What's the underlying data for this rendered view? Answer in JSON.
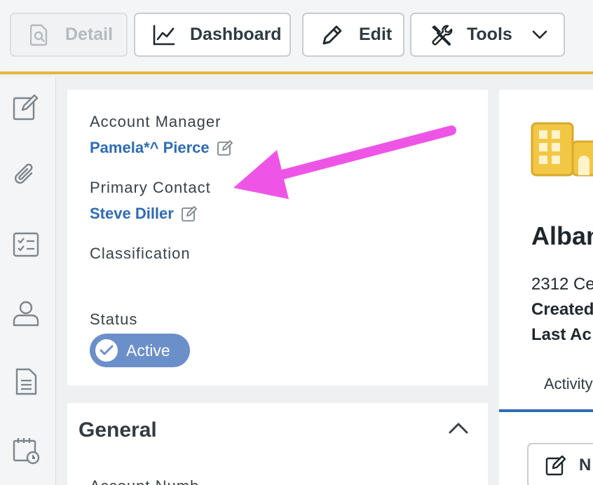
{
  "toolbar": {
    "detail_label": "Detail",
    "dashboard_label": "Dashboard",
    "edit_label": "Edit",
    "tools_label": "Tools",
    "accent_color": "#e8b63c"
  },
  "sidebar": {
    "items": [
      {
        "icon": "compose-icon"
      },
      {
        "icon": "paperclip-icon"
      },
      {
        "icon": "checklist-icon"
      },
      {
        "icon": "contact-icon"
      },
      {
        "icon": "document-icon"
      },
      {
        "icon": "calendar-clock-icon"
      }
    ]
  },
  "contacts_card": {
    "account_manager_label": "Account Manager",
    "account_manager_value": "Pamela*^ Pierce",
    "primary_contact_label": "Primary Contact",
    "primary_contact_value": "Steve Diller",
    "classification_label": "Classification",
    "status_label": "Status",
    "status_value": "Active",
    "status_color": "#6b8fc9",
    "link_color": "#2f6bb3"
  },
  "general_section": {
    "title": "General",
    "first_field_label": "Account Numb"
  },
  "company_panel": {
    "name": "Alban",
    "address": "2312 Ce",
    "created_label": "Created",
    "last_activity_label": "Last Ac",
    "tab_label": "Activity",
    "new_note_label": "N",
    "logo_color": "#f2c744"
  },
  "annotation": {
    "arrow_color": "#ee55e6"
  }
}
